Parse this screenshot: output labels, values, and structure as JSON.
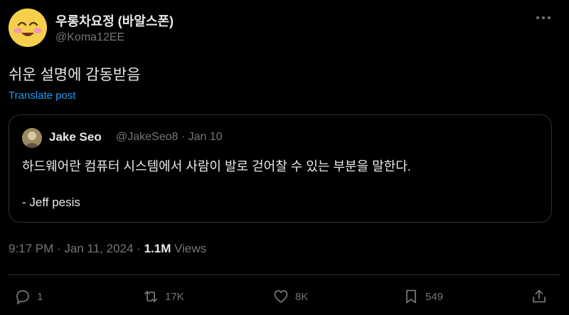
{
  "author": {
    "display_name": "우롱차요정 (바알스폰)",
    "handle": "@Koma12EE",
    "avatar_icon": "smiling-face-icon"
  },
  "post": {
    "text": "쉬운 설명에 감동받음",
    "translate_label": "Translate post"
  },
  "quoted": {
    "display_name": "Jake Seo",
    "meta": "@JakeSeo8 · Jan 10",
    "text": "하드웨어란 컴퓨터 시스템에서 사람이 발로 걷어찰 수 있는 부분을 말한다.",
    "attribution": "- Jeff pesis"
  },
  "meta": {
    "datetime": "9:17 PM · Jan 11, 2024 · ",
    "views_count": "1.1M",
    "views_label": " Views"
  },
  "actions": {
    "reply": {
      "icon": "reply-icon",
      "count": "1"
    },
    "repost": {
      "icon": "repost-icon",
      "count": "17K"
    },
    "like": {
      "icon": "heart-icon",
      "count": "8K"
    },
    "bookmark": {
      "icon": "bookmark-icon",
      "count": "549"
    },
    "share": {
      "icon": "share-icon"
    }
  },
  "colors": {
    "background": "#000000",
    "text": "#e7e9ea",
    "muted": "#71767b",
    "link": "#1d9bf0",
    "border": "#2f3336"
  }
}
